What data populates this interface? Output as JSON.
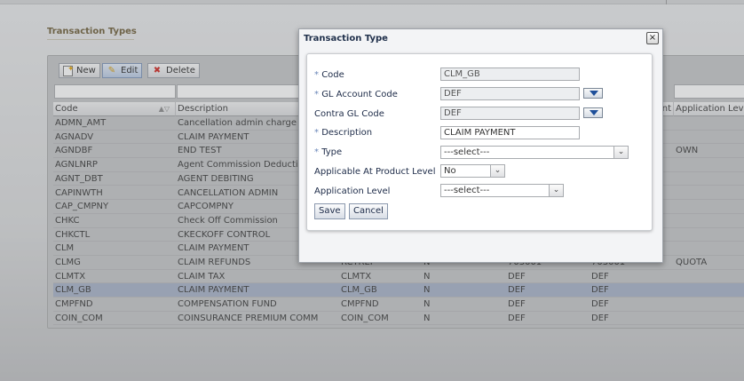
{
  "page": {
    "section_title": "Transaction Types"
  },
  "toolbar": {
    "new_label": "New",
    "edit_label": "Edit",
    "delete_label": "Delete"
  },
  "table": {
    "columns": [
      "Code",
      "Description",
      "",
      "",
      "",
      "nt",
      "Application Level"
    ],
    "rows": [
      [
        "ADMN_AMT",
        "Cancellation admin charge",
        "",
        "",
        "",
        "",
        ""
      ],
      [
        "AGNADV",
        "CLAIM PAYMENT",
        "",
        "",
        "",
        "",
        ""
      ],
      [
        "AGNDBF",
        "END TEST",
        "",
        "",
        "",
        "",
        "OWN"
      ],
      [
        "AGNLNRP",
        "Agent Commission Deductions",
        "",
        "",
        "",
        "",
        ""
      ],
      [
        "AGNT_DBT",
        "AGENT DEBITING",
        "",
        "",
        "",
        "",
        ""
      ],
      [
        "CAPINWTH",
        "CANCELLATION ADMIN",
        "",
        "",
        "",
        "",
        ""
      ],
      [
        "CAP_CMPNY",
        "CAPCOMPNY",
        "",
        "",
        "",
        "",
        ""
      ],
      [
        "CHKC",
        "Check Off Commission",
        "",
        "",
        "",
        "",
        ""
      ],
      [
        "CHKCTL",
        "CKECKOFF CONTROL",
        "",
        "",
        "",
        "",
        ""
      ],
      [
        "CLM",
        "CLAIM PAYMENT",
        "",
        "",
        "",
        "",
        ""
      ],
      [
        "CLMG",
        "CLAIM REFUNDS",
        "RCTREF",
        "N",
        "703001",
        "703001",
        "QUOTA"
      ],
      [
        "CLMTX",
        "CLAIM TAX",
        "CLMTX",
        "N",
        "DEF",
        "DEF",
        ""
      ],
      [
        "CLM_GB",
        "CLAIM PAYMENT",
        "CLM_GB",
        "N",
        "DEF",
        "DEF",
        ""
      ],
      [
        "CMPFND",
        "COMPENSATION FUND",
        "CMPFND",
        "N",
        "DEF",
        "DEF",
        ""
      ],
      [
        "COIN_COM",
        "COINSURANCE PREMIUM COMM",
        "COIN_COM",
        "N",
        "DEF",
        "DEF",
        ""
      ]
    ]
  },
  "dialog": {
    "title": "Transaction Type",
    "close": "×",
    "required_mark": "*",
    "labels": {
      "code": "Code",
      "gl_account_code": "GL Account Code",
      "contra_gl_code": "Contra GL Code",
      "description": "Description",
      "type": "Type",
      "applicable_product": "Applicable At Product Level",
      "application_level": "Application Level"
    },
    "values": {
      "code": "CLM_GB",
      "gl_account_code": "DEF",
      "contra_gl_code": "DEF",
      "description": "CLAIM PAYMENT",
      "type": "---select---",
      "applicable_product": "No",
      "application_level": "---select---"
    },
    "save_label": "Save",
    "cancel_label": "Cancel"
  },
  "icons": {
    "new": "new-document-icon",
    "edit": "pencil-icon",
    "delete": "red-x-icon",
    "sort": "sort-arrows-icon",
    "lov": "lov-dropdown-icon",
    "close": "close-icon"
  }
}
